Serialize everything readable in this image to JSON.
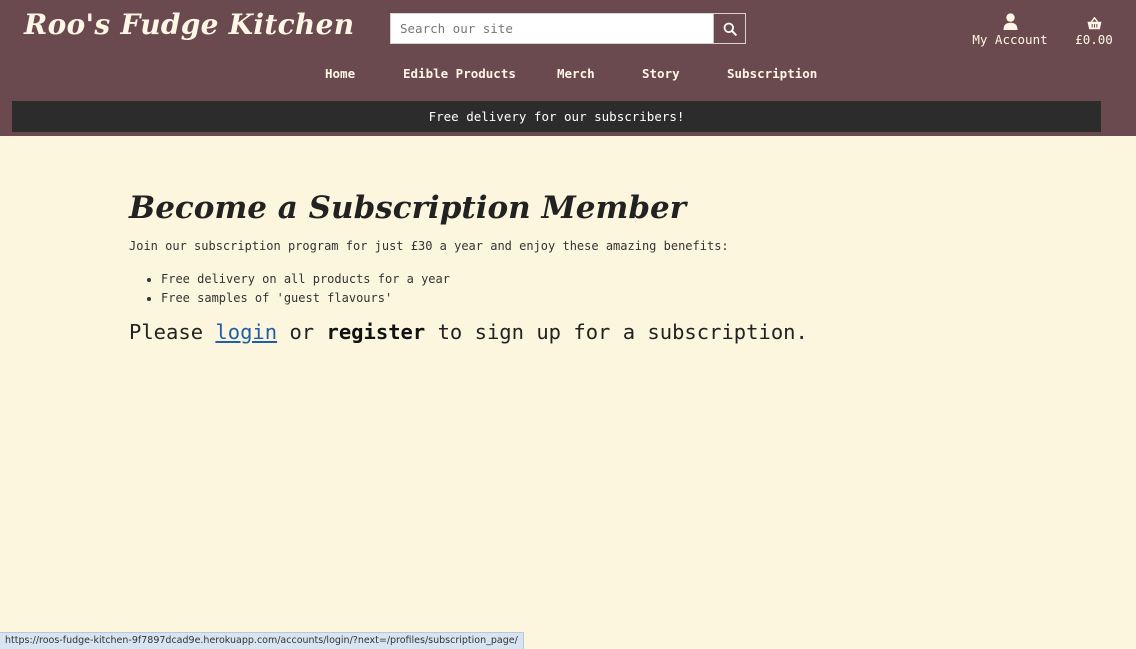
{
  "header": {
    "logo_text": "Roo's Fudge Kitchen",
    "search": {
      "placeholder": "Search our site",
      "value": ""
    },
    "account_label": "My Account",
    "cart_total": "£0.00"
  },
  "nav": {
    "items": [
      {
        "label": "Home"
      },
      {
        "label": "Edible Products"
      },
      {
        "label": "Merch"
      },
      {
        "label": "Story"
      },
      {
        "label": "Subscription"
      }
    ]
  },
  "banner": {
    "text": "Free delivery for our subscribers!"
  },
  "main": {
    "title": "Become a Subscription Member",
    "intro": "Join our subscription program for just £30 a year and enjoy these amazing benefits:",
    "benefits": [
      "Free delivery on all products for a year",
      "Free samples of 'guest flavours'"
    ],
    "signup": {
      "prefix": "Please ",
      "login_label": "login",
      "middle": " or ",
      "register_label": "register",
      "suffix": " to sign up for a subscription."
    }
  },
  "status_bar": {
    "url": "https://roos-fudge-kitchen-9f7897dcad9e.herokuapp.com/accounts/login/?next=/profiles/subscription_page/"
  },
  "colors": {
    "header_bg": "#6a4a4e",
    "banner_bg": "#2d2c2c",
    "page_bg": "#fdf6df",
    "link": "#1f5fa8"
  },
  "icons": [
    "search-icon",
    "user-icon",
    "basket-icon"
  ]
}
